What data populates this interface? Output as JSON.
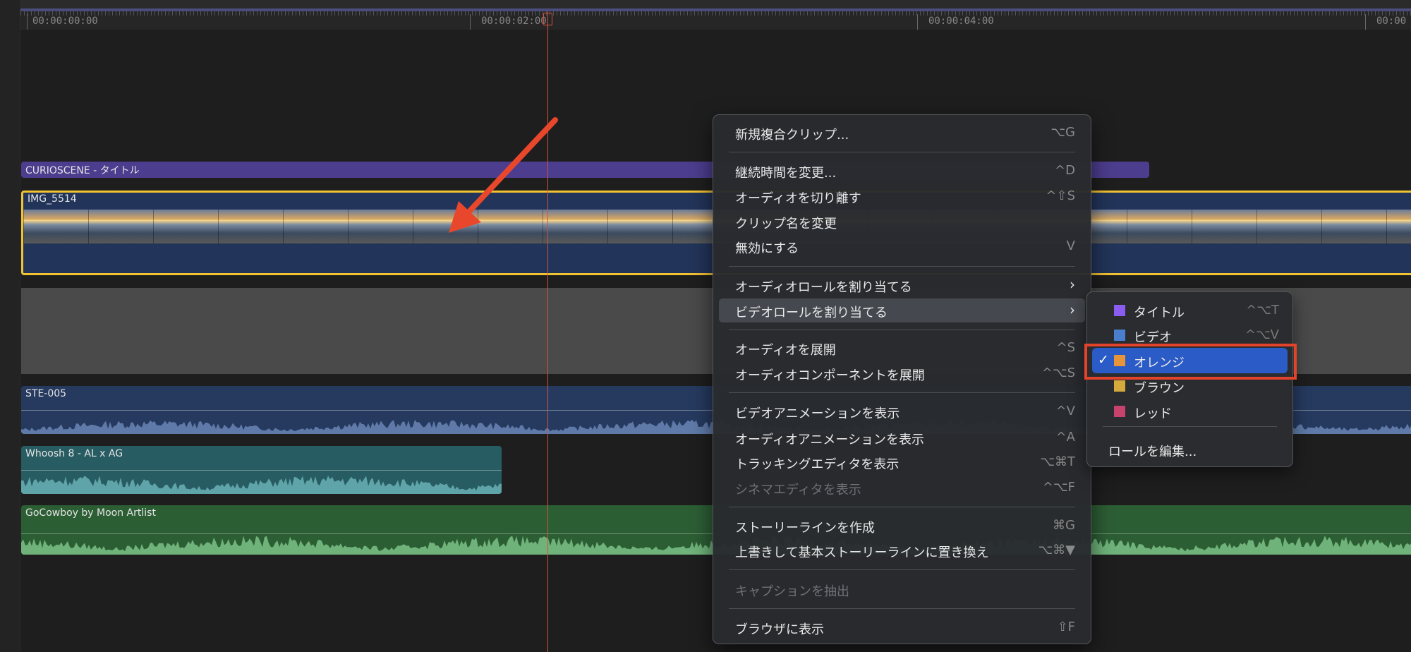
{
  "ruler": {
    "timecodes": [
      "00:00:00:00",
      "00:00:02:00",
      "00:00:04:00",
      "00:00"
    ]
  },
  "clips": {
    "title": {
      "name": "CURIOSCENE - タイトル",
      "color": "#4d3d8e"
    },
    "video": {
      "name": "IMG_5514",
      "color": "#223459"
    },
    "ste": {
      "name": "STE-005",
      "color": "#263a5f"
    },
    "whoosh": {
      "name": "Whoosh 8 - AL x AG",
      "color": "#275c62"
    },
    "cowboy": {
      "name": "GoCowboy by Moon Artlist",
      "color": "#2c5e34"
    }
  },
  "menu": {
    "items": [
      {
        "label": "新規複合クリップ...",
        "shortcut": "⌥G"
      },
      {
        "label": "継続時間を変更...",
        "shortcut": "^D"
      },
      {
        "label": "オーディオを切り離す",
        "shortcut": "^⇧S"
      },
      {
        "label": "クリップ名を変更",
        "shortcut": ""
      },
      {
        "label": "無効にする",
        "shortcut": "V"
      },
      {
        "label": "オーディオロールを割り当てる",
        "shortcut": "›"
      },
      {
        "label": "ビデオロールを割り当てる",
        "shortcut": "›"
      },
      {
        "label": "オーディオを展開",
        "shortcut": "^S"
      },
      {
        "label": "オーディオコンポーネントを展開",
        "shortcut": "^⌥S"
      },
      {
        "label": "ビデオアニメーションを表示",
        "shortcut": "^V"
      },
      {
        "label": "オーディオアニメーションを表示",
        "shortcut": "^A"
      },
      {
        "label": "トラッキングエディタを表示",
        "shortcut": "⌥⌘T"
      },
      {
        "label": "シネマエディタを表示",
        "shortcut": "^⌥F"
      },
      {
        "label": "ストーリーラインを作成",
        "shortcut": "⌘G"
      },
      {
        "label": "上書きして基本ストーリーラインに置き換え",
        "shortcut": "⌥⌘▼"
      },
      {
        "label": "キャプションを抽出",
        "shortcut": ""
      },
      {
        "label": "ブラウザに表示",
        "shortcut": "⇧F"
      }
    ]
  },
  "submenu": {
    "items": [
      {
        "label": "タイトル",
        "shortcut": "^⌥T",
        "color": "#8a5cf0"
      },
      {
        "label": "ビデオ",
        "shortcut": "^⌥V",
        "color": "#4a7fd0"
      },
      {
        "label": "オレンジ",
        "shortcut": "",
        "color": "#e8943a",
        "check": "✓"
      },
      {
        "label": "ブラウン",
        "shortcut": "",
        "color": "#d4aa3c"
      },
      {
        "label": "レッド",
        "shortcut": "",
        "color": "#c8426e"
      }
    ],
    "edit": "ロールを編集..."
  }
}
